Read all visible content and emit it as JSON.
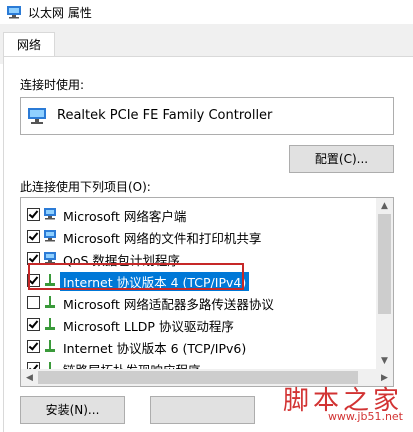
{
  "window": {
    "title": "以太网 属性"
  },
  "tabs": [
    {
      "label": "网络"
    }
  ],
  "connect_using_label": "连接时使用:",
  "adapter": {
    "name": "Realtek PCIe FE Family Controller"
  },
  "configure_button": "配置(C)...",
  "items_label": "此连接使用下列项目(O):",
  "items": [
    {
      "label": "Microsoft 网络客户端",
      "checked": true,
      "icon": "network-client-icon"
    },
    {
      "label": "Microsoft 网络的文件和打印机共享",
      "checked": true,
      "icon": "file-share-icon"
    },
    {
      "label": "QoS 数据包计划程序",
      "checked": true,
      "icon": "qos-icon"
    },
    {
      "label": "Internet 协议版本 4 (TCP/IPv4)",
      "checked": true,
      "icon": "protocol-icon",
      "selected": true
    },
    {
      "label": "Microsoft 网络适配器多路传送器协议",
      "checked": false,
      "icon": "protocol-icon"
    },
    {
      "label": "Microsoft LLDP 协议驱动程序",
      "checked": true,
      "icon": "protocol-icon"
    },
    {
      "label": "Internet 协议版本 6 (TCP/IPv6)",
      "checked": true,
      "icon": "protocol-icon"
    },
    {
      "label": "链路层拓扑发现响应程序",
      "checked": true,
      "icon": "protocol-icon"
    }
  ],
  "install_button": "安装(N)...",
  "watermark": {
    "text": "脚本之家",
    "url": "www.jb51.net"
  },
  "colors": {
    "selection": "#0078d7",
    "highlight_border": "#c62828",
    "watermark": "#d23333"
  }
}
